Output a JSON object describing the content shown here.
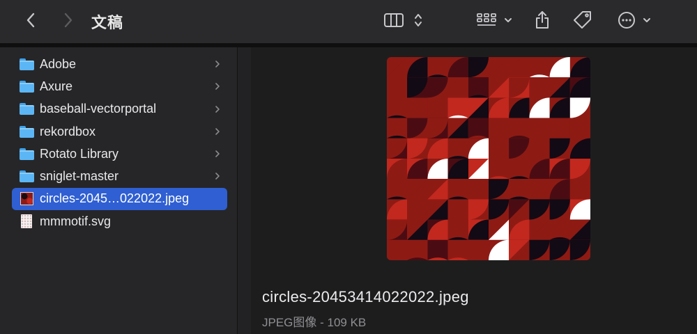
{
  "window": {
    "title": "文稿"
  },
  "toolbar": {
    "back_icon": "chevron-left",
    "forward_icon": "chevron-right",
    "view_icon": "columns-view",
    "group_icon": "grid-group",
    "share_icon": "share",
    "tag_icon": "tag",
    "more_icon": "ellipsis-circle"
  },
  "sidebar": {
    "items": [
      {
        "label": "Adobe",
        "type": "folder",
        "has_children": true
      },
      {
        "label": "Axure",
        "type": "folder",
        "has_children": true
      },
      {
        "label": "baseball-vectorportal",
        "type": "folder",
        "has_children": true
      },
      {
        "label": "rekordbox",
        "type": "folder",
        "has_children": true
      },
      {
        "label": "Rotato Library",
        "type": "folder",
        "has_children": true
      },
      {
        "label": "sniglet-master",
        "type": "folder",
        "has_children": true
      },
      {
        "label": "circles-2045…022022.jpeg",
        "type": "jpeg",
        "has_children": false,
        "selected": true
      },
      {
        "label": "mmmotif.svg",
        "type": "svg",
        "has_children": false
      }
    ]
  },
  "preview": {
    "filename": "circles-20453414022022.jpeg",
    "meta": "JPEG图像 - 109 KB"
  },
  "colors": {
    "selection": "#2f5fd2",
    "folder": "#5cb6f5",
    "pattern_red": "#8e1a14",
    "pattern_bright": "#c2281e",
    "pattern_dark": "#120a14",
    "pattern_wine": "#4a0c12"
  }
}
